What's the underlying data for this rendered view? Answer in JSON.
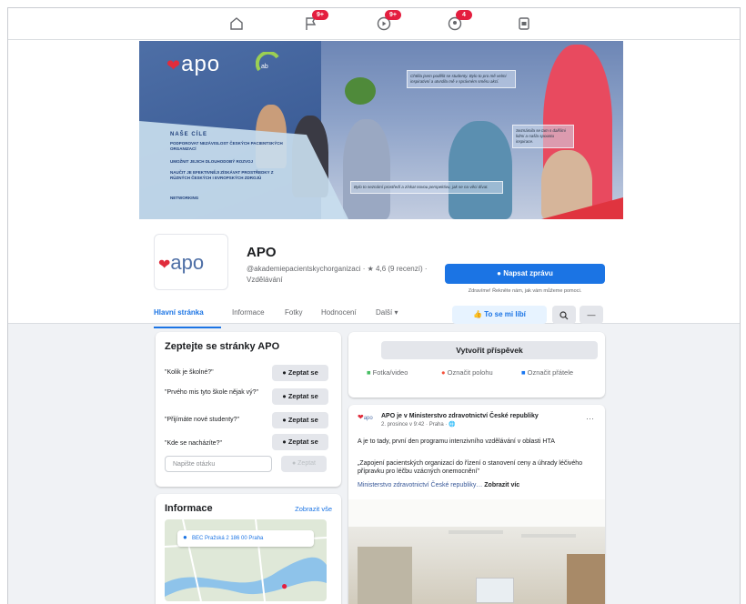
{
  "nav": {
    "items": [
      {
        "icon": "home-icon",
        "badge": ""
      },
      {
        "icon": "flag-icon",
        "badge": "9+"
      },
      {
        "icon": "video-icon",
        "badge": "9+"
      },
      {
        "icon": "marketplace-icon",
        "badge": "4"
      },
      {
        "icon": "gaming-icon",
        "badge": ""
      }
    ]
  },
  "cover": {
    "logo_text": "apo",
    "goals_title": "NAŠE CÍLE",
    "goals": [
      "PODPOROVAT NEZÁVISLOST ČESKÝCH PACIENTSKÝCH ORGANIZACÍ",
      "UMOŽNIT JEJICH DLOUHODOBÝ ROZVOJ",
      "NAUČIT JE EFEKTIVNĚJI ZÍSKÁVAT PROSTŘEDKY Z RŮZNÝCH ČESKÝCH I EVROPSKÝCH ZDROJŮ",
      "NETWORKING"
    ],
    "quotes": [
      "Chtěla jsem podělit se studenty. Bylo to pro mě velmi inspirativní a utvrdila mě v správném směru akcí.",
      "Seznámila se tam s dalšími lidmi a našla spoustu inspirace.",
      "Bylo to seznámí prostředí a získat novou perspektivu, jak se na věci dívat."
    ]
  },
  "page": {
    "avatar_text": "apo",
    "name": "APO",
    "handle_line": "@akademiepacientskychorganizaci · ★ 4,6 (9 recenzí) · Vzdělávání",
    "message_button": "Napsat zprávu",
    "message_note": "Zdravíme! Řekněte nám, jak vám můžeme pomoci.",
    "tabs": [
      "Hlavní stránka",
      "Informace",
      "Fotky",
      "Hodnocení",
      "Další ▾"
    ],
    "like_button": "To se mi líbí",
    "search_icon": "search-icon",
    "more_icon": "more-icon"
  },
  "ask": {
    "title": "Zeptejte se stránky APO",
    "questions": [
      "\"Kolik je školné?\"",
      "\"Prvého mis tyto škole nějak vý?\"",
      "\"Přijímáte nové studenty?\"",
      "\"Kde se nacházíte?\""
    ],
    "button_label": "Zeptat se",
    "input_placeholder": "Napište otázku",
    "send_label": "Zeptat"
  },
  "info": {
    "title": "Informace",
    "see_all": "Zobrazit vše",
    "address": "BEC Pražská 2 186 00 Praha"
  },
  "composer": {
    "create_post": "Vytvořit příspěvek",
    "actions": [
      "Fotka/video",
      "Označit polohu",
      "Označit přátele"
    ]
  },
  "post": {
    "author": "APO je v Ministerstvo zdravotnictví České republiky",
    "meta": "2. prosince v 9:42 · Praha · 🌐",
    "text1": "A je to tady, první den programu intenzivního vzdělávání v oblasti HTA",
    "text2": "„Zapojení pacientských organizací do řízení o stanovení ceny a úhrady léčivého přípravku pro léčbu vzácných onemocnění\"",
    "link": "Ministerstvo zdravotnictví České republiky…",
    "see_more": "Zobrazit víc"
  },
  "colors": {
    "accent": "#1b74e4",
    "brand_red": "#e02c3c",
    "cover_blue": "#4e6fa6"
  }
}
